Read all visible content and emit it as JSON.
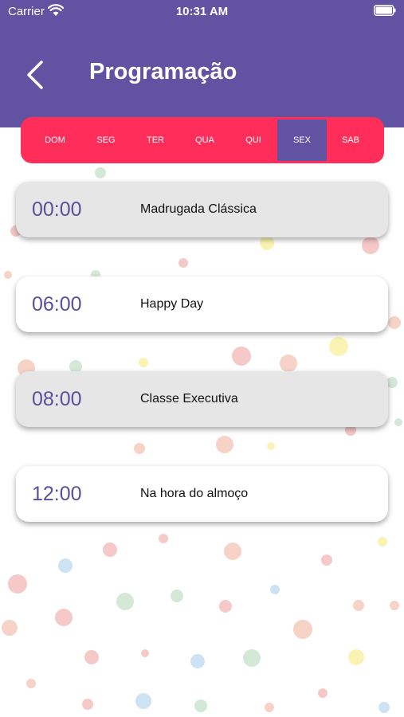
{
  "status_bar": {
    "carrier": "Carrier",
    "time": "10:31 AM"
  },
  "header": {
    "title": "Programação",
    "back_icon": "chevron-left-icon"
  },
  "days": [
    "DOM",
    "SEG",
    "TER",
    "QUA",
    "QUI",
    "SEX",
    "SAB"
  ],
  "selected_day": "SEX",
  "schedule": [
    {
      "time": "00:00",
      "program": "Madrugada Clássica",
      "shaded": true
    },
    {
      "time": "06:00",
      "program": "Happy Day",
      "shaded": false
    },
    {
      "time": "08:00",
      "program": "Classe Executiva",
      "shaded": true
    },
    {
      "time": "12:00",
      "program": "Na hora do almoço",
      "shaded": false
    }
  ],
  "colors": {
    "header": "#6153a1",
    "tabs": "#ff2d5a",
    "selected_tab": "#6153a1",
    "time_text": "#5b4f9c",
    "card_shaded": "#e6e6e6",
    "card_plain": "#ffffff"
  }
}
